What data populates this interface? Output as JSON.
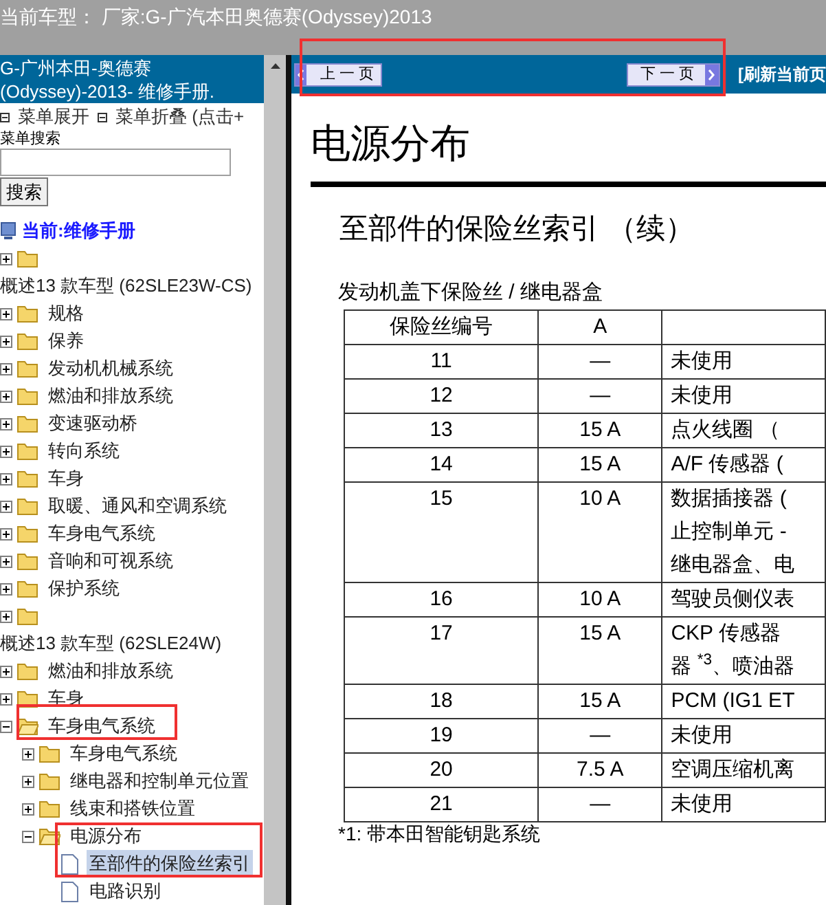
{
  "top_bar": {
    "text": "当前车型：  厂家:G-广汽本田奥德赛(Odyssey)2013"
  },
  "sidebar": {
    "header": [
      "G-广州本田-奥德赛",
      "(Odyssey)-2013- 维修手册."
    ],
    "menu_links": [
      "菜单展开",
      "菜单折叠 (点击+"
    ],
    "search": {
      "label": "菜单搜索",
      "button": "搜索"
    },
    "tree_root": "当前:维修手册",
    "tree": [
      {
        "kind": "folder",
        "expanded": false
      },
      {
        "kind": "caption",
        "label": "概述13 款车型 (62SLE23W-CS)"
      },
      {
        "kind": "folder",
        "label": "规格",
        "expanded": false
      },
      {
        "kind": "folder",
        "label": "保养",
        "expanded": false
      },
      {
        "kind": "folder",
        "label": "发动机机械系统",
        "expanded": false
      },
      {
        "kind": "folder",
        "label": "燃油和排放系统",
        "expanded": false
      },
      {
        "kind": "folder",
        "label": "变速驱动桥",
        "expanded": false
      },
      {
        "kind": "folder",
        "label": "转向系统",
        "expanded": false
      },
      {
        "kind": "folder",
        "label": "车身",
        "expanded": false
      },
      {
        "kind": "folder",
        "label": "取暖、通风和空调系统",
        "expanded": false
      },
      {
        "kind": "folder",
        "label": "车身电气系统",
        "expanded": false
      },
      {
        "kind": "folder",
        "label": "音响和可视系统",
        "expanded": false
      },
      {
        "kind": "folder",
        "label": "保护系统",
        "expanded": false
      },
      {
        "kind": "folder",
        "expanded": false
      },
      {
        "kind": "caption",
        "label": "概述13 款车型 (62SLE24W)"
      },
      {
        "kind": "folder",
        "label": "燃油和排放系统",
        "expanded": false
      },
      {
        "kind": "folder",
        "label": "车身",
        "expanded": false
      },
      {
        "kind": "folder",
        "label": "车身电气系统",
        "expanded": true,
        "children": [
          {
            "kind": "folder",
            "label": "车身电气系统",
            "expanded": false
          },
          {
            "kind": "folder",
            "label": "继电器和控制单元位置",
            "expanded": false
          },
          {
            "kind": "folder",
            "label": "线束和搭铁位置",
            "expanded": false
          },
          {
            "kind": "folder",
            "label": "电源分布",
            "expanded": true,
            "children": [
              {
                "kind": "page",
                "label": "至部件的保险丝索引",
                "selected": true
              },
              {
                "kind": "page",
                "label": "电路识别",
                "selected": false
              }
            ]
          }
        ]
      }
    ]
  },
  "nav": {
    "prev": "上 一 页",
    "next": "下 一 页",
    "refresh": "[刷新当前页"
  },
  "document": {
    "title": "电源分布",
    "subtitle": "至部件的保险丝索引 （续）",
    "section": "发动机盖下保险丝 / 继电器盒",
    "columns": [
      "保险丝编号",
      "A"
    ],
    "rows": [
      {
        "fuse": "11",
        "amp": "—",
        "lines": [
          "未使用"
        ]
      },
      {
        "fuse": "12",
        "amp": "—",
        "lines": [
          "未使用"
        ]
      },
      {
        "fuse": "13",
        "amp": "15 A",
        "lines": [
          "点火线圈 （"
        ]
      },
      {
        "fuse": "14",
        "amp": "15 A",
        "lines": [
          "A/F 传感器 ("
        ]
      },
      {
        "fuse": "15",
        "amp": "10 A",
        "lines": [
          "数据插接器 (",
          "止控制单元 -",
          "继电器盒、电"
        ]
      },
      {
        "fuse": "16",
        "amp": "10 A",
        "lines": [
          "驾驶员侧仪表"
        ]
      },
      {
        "fuse": "17",
        "amp": "15 A",
        "lines": [
          "CKP 传感器",
          "器 $^{*3}$、喷油器"
        ]
      },
      {
        "fuse": "18",
        "amp": "15 A",
        "lines": [
          "PCM (IG1 ET"
        ]
      },
      {
        "fuse": "19",
        "amp": "—",
        "lines": [
          "未使用"
        ]
      },
      {
        "fuse": "20",
        "amp": "7.5 A",
        "lines": [
          "空调压缩机离"
        ]
      },
      {
        "fuse": "21",
        "amp": "—",
        "lines": [
          "未使用"
        ]
      }
    ],
    "footnote": "*1: 带本田智能钥匙系统"
  }
}
